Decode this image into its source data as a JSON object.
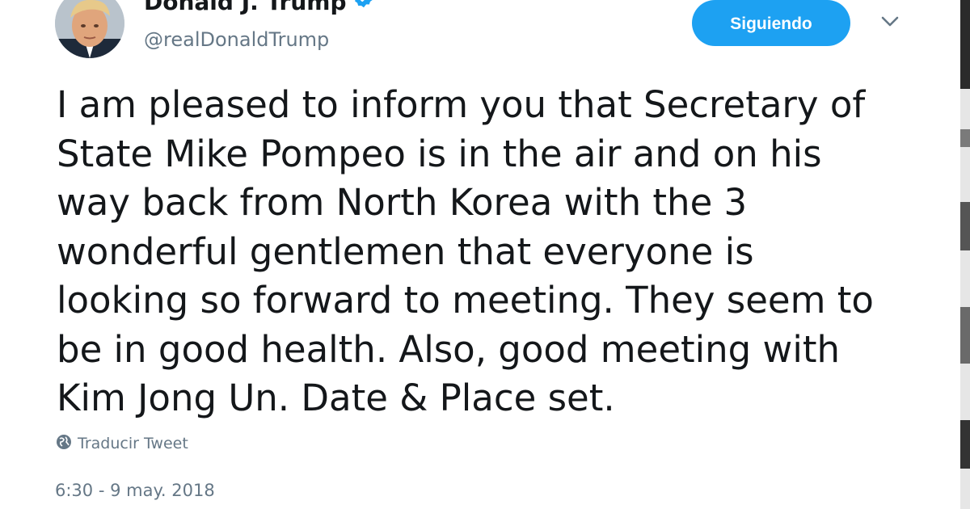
{
  "user": {
    "display_name": "Donald J. Trump",
    "handle": "@realDonaldTrump",
    "verified": true
  },
  "actions": {
    "follow_label": "Siguiendo"
  },
  "tweet": {
    "text": "I am pleased to inform you that Secretary of\nState Mike Pompeo is in the air and on his\nway back from North Korea with the 3\nwonderful gentlemen that everyone is\nlooking so forward to meeting. They seem to\nbe in good health. Also, good meeting with\nKim Jong Un. Date & Place set.",
    "translate_label": "Traducir Tweet",
    "timestamp": "6:30 - 9 may. 2018"
  },
  "colors": {
    "accent": "#1da1f2",
    "text": "#14171a",
    "secondary_text": "#657786"
  },
  "icons": {
    "verified": "verified-badge-icon",
    "menu": "chevron-down-icon",
    "translate": "globe-icon"
  }
}
